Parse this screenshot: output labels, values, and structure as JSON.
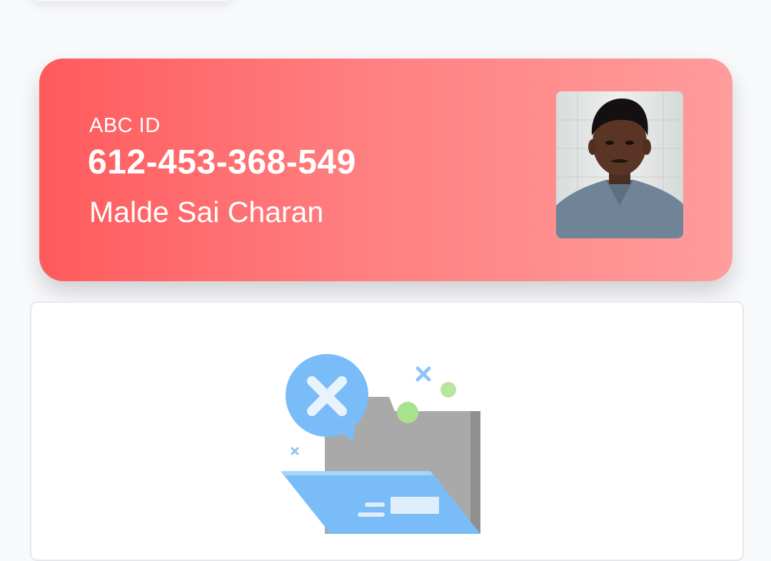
{
  "abc_card": {
    "label": "ABC ID",
    "id_number": "612-453-368-549",
    "holder_name": "Malde Sai Charan"
  },
  "colors": {
    "card_gradient_start": "#ff5a5c",
    "card_gradient_end": "#ff9c9c",
    "illustration_blue": "#7fc0fb",
    "illustration_gray": "#a8a8a8",
    "illustration_green": "#a9e28c"
  },
  "empty_state": {
    "icon": "no-documents-illustration"
  }
}
